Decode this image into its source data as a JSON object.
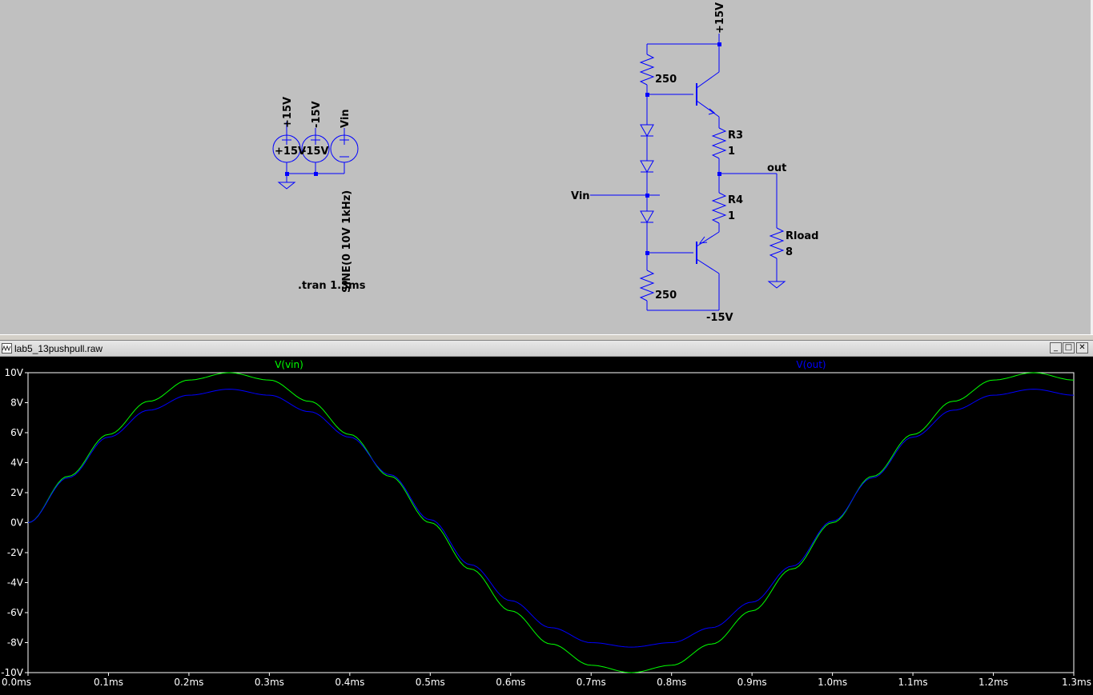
{
  "schematic": {
    "sources": {
      "nets": [
        "+15V",
        "-15V",
        "Vin"
      ],
      "values": [
        "+15V",
        "-15V"
      ],
      "sine_value": "SINE(0 10V 1kHz)",
      "directive": ".tran 1.3ms"
    },
    "circuit": {
      "vcc_label": "+15V",
      "vee_label": "-15V",
      "vin_label": "Vin",
      "out_label": "out",
      "r_top_value": "250",
      "r_bottom_value": "250",
      "r3_name": "R3",
      "r3_value": "1",
      "r4_name": "R4",
      "r4_value": "1",
      "rload_name": "Rload",
      "rload_value": "8"
    },
    "colors": {
      "wire": "#0000ff",
      "background": "#c0c0c0",
      "text": "#000000"
    }
  },
  "plot_window": {
    "title": "lab5_13pushpull.raw",
    "buttons": {
      "minimize": "_",
      "maximize": "□",
      "close": "✕"
    }
  },
  "chart_data": {
    "type": "line",
    "x_unit": "ms",
    "xlim": [
      0.0,
      1.3
    ],
    "ylim": [
      -10,
      10
    ],
    "x_ticks": [
      "0.0ms",
      "0.1ms",
      "0.2ms",
      "0.3ms",
      "0.4ms",
      "0.5ms",
      "0.6ms",
      "0.7ms",
      "0.8ms",
      "0.9ms",
      "1.0ms",
      "1.1ms",
      "1.2ms",
      "1.3ms"
    ],
    "y_ticks": [
      "10V",
      "8V",
      "6V",
      "4V",
      "2V",
      "0V",
      "-2V",
      "-4V",
      "-6V",
      "-8V",
      "-10V"
    ],
    "y_tick_values": [
      10,
      8,
      6,
      4,
      2,
      0,
      -2,
      -4,
      -6,
      -8,
      -10
    ],
    "background": "#000000",
    "series": [
      {
        "name": "V(vin)",
        "color": "#00ff00",
        "x": [
          0,
          0.05,
          0.1,
          0.15,
          0.2,
          0.25,
          0.3,
          0.35,
          0.4,
          0.45,
          0.5,
          0.55,
          0.6,
          0.65,
          0.7,
          0.75,
          0.8,
          0.85,
          0.9,
          0.95,
          1.0,
          1.05,
          1.1,
          1.15,
          1.2,
          1.25,
          1.3
        ],
        "values": [
          0,
          3.09,
          5.88,
          8.09,
          9.51,
          10,
          9.51,
          8.09,
          5.88,
          3.09,
          0,
          -3.09,
          -5.88,
          -8.09,
          -9.51,
          -10,
          -9.51,
          -8.09,
          -5.88,
          -3.09,
          0,
          3.09,
          5.88,
          8.09,
          9.51,
          10,
          9.51
        ]
      },
      {
        "name": "V(out)",
        "color": "#0000ff",
        "x": [
          0,
          0.05,
          0.1,
          0.15,
          0.2,
          0.25,
          0.3,
          0.35,
          0.4,
          0.45,
          0.5,
          0.55,
          0.6,
          0.65,
          0.7,
          0.75,
          0.8,
          0.85,
          0.9,
          0.95,
          1.0,
          1.05,
          1.1,
          1.15,
          1.2,
          1.25,
          1.3
        ],
        "values": [
          0,
          3.0,
          5.7,
          7.5,
          8.5,
          8.9,
          8.5,
          7.4,
          5.7,
          3.2,
          0.2,
          -2.8,
          -5.2,
          -7.0,
          -8.0,
          -8.3,
          -8.0,
          -7.0,
          -5.3,
          -2.9,
          0.1,
          3.0,
          5.7,
          7.5,
          8.5,
          8.9,
          8.5
        ]
      }
    ]
  }
}
